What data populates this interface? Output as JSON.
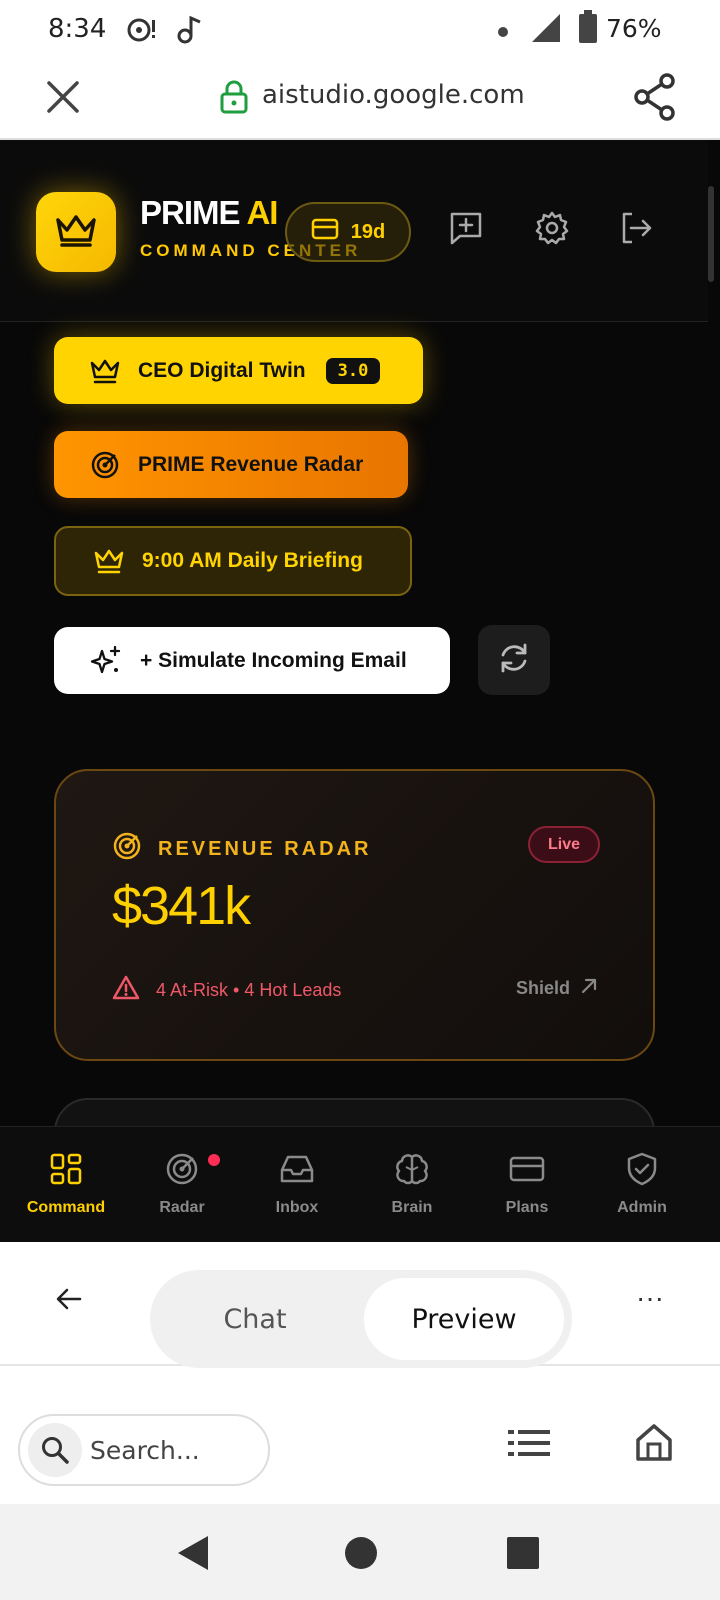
{
  "status_bar": {
    "time": "8:34",
    "battery": "76%"
  },
  "browser": {
    "url": "aistudio.google.com",
    "search_placeholder": "Search..."
  },
  "app": {
    "brand_main": "PRIME",
    "brand_accent": "AI",
    "brand_sub": "COMMAND CENTER",
    "trial_days": "19d",
    "buttons": {
      "ceo_twin": "CEO Digital Twin",
      "ceo_twin_version": "3.0",
      "revenue_radar": "PRIME Revenue Radar",
      "daily_briefing": "9:00 AM Daily Briefing",
      "simulate_email": "+ Simulate Incoming Email"
    },
    "radar_card": {
      "title": "REVENUE RADAR",
      "status": "Live",
      "amount": "$341k",
      "summary": "4 At-Risk • 4 Hot Leads",
      "link": "Shield"
    },
    "tabs": [
      {
        "label": "Command",
        "icon": "grid-icon",
        "active": true
      },
      {
        "label": "Radar",
        "icon": "radar-icon",
        "badge": true
      },
      {
        "label": "Inbox",
        "icon": "inbox-icon"
      },
      {
        "label": "Brain",
        "icon": "brain-icon"
      },
      {
        "label": "Plans",
        "icon": "card-icon"
      },
      {
        "label": "Admin",
        "icon": "shield-check-icon"
      }
    ]
  },
  "preview_toggle": {
    "chat": "Chat",
    "preview": "Preview",
    "more": "···"
  },
  "colors": {
    "gold": "#ffd000",
    "orange": "#ff9500",
    "alert": "#ee5869",
    "live_red": "#ff7a8a"
  }
}
